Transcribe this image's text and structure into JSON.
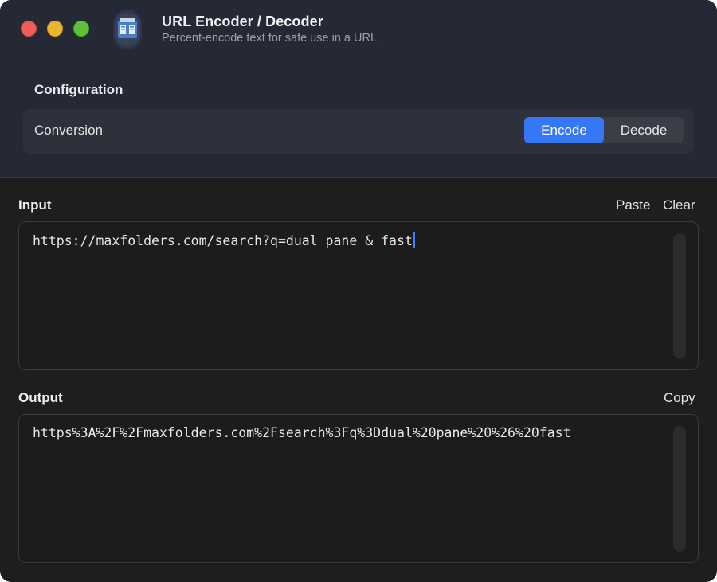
{
  "window": {
    "title": "URL Encoder / Decoder",
    "subtitle": "Percent-encode text for safe use in a URL"
  },
  "configuration": {
    "heading": "Configuration",
    "conversion_label": "Conversion",
    "modes": [
      "Encode",
      "Decode"
    ],
    "selected_mode": "Encode"
  },
  "input": {
    "heading": "Input",
    "paste_label": "Paste",
    "clear_label": "Clear",
    "value": "https://maxfolders.com/search?q=dual pane & fast"
  },
  "output": {
    "heading": "Output",
    "copy_label": "Copy",
    "value": "https%3A%2F%2Fmaxfolders.com%2Fsearch%3Fq%3Ddual%20pane%20%26%20fast"
  },
  "colors": {
    "accent": "#3478f6",
    "header_bg": "#252936",
    "body_bg": "#1e1e1f"
  }
}
